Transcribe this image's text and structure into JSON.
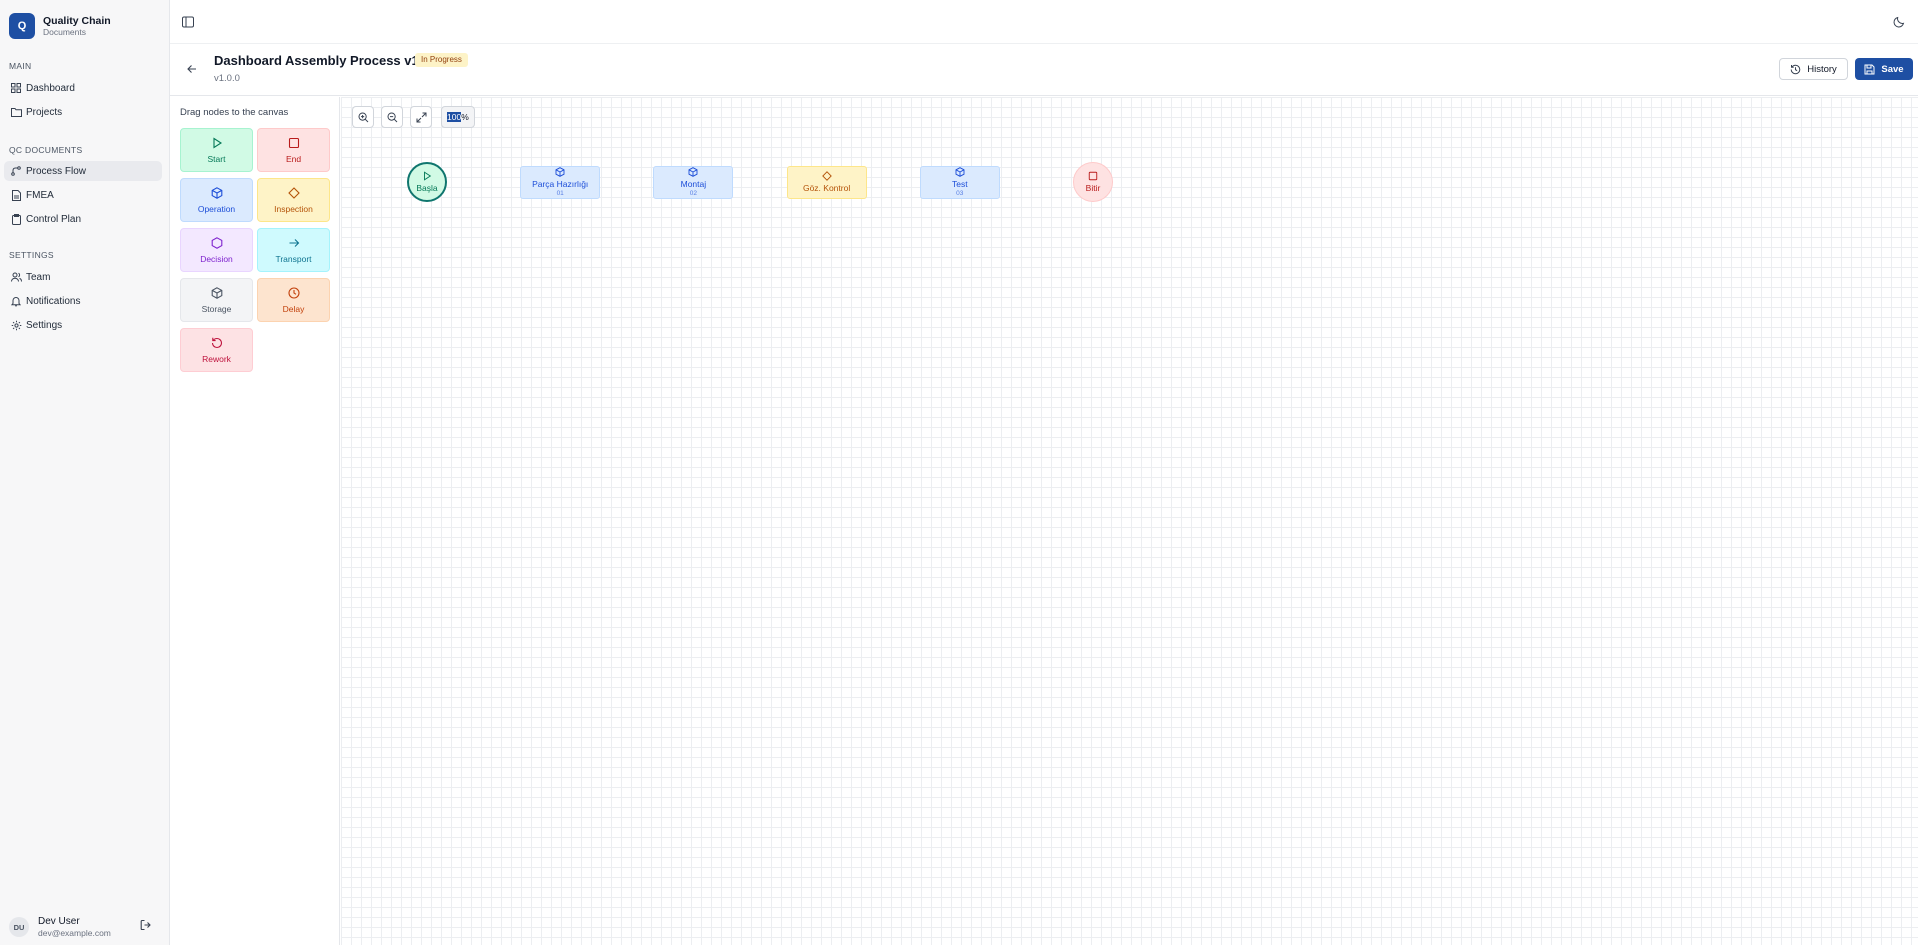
{
  "app": {
    "name": "Quality Chain",
    "subtitle": "Documents",
    "logo_letter": "Q"
  },
  "sidebar": {
    "sections": [
      {
        "label": "MAIN",
        "items": [
          {
            "label": "Dashboard",
            "icon": "grid-icon"
          },
          {
            "label": "Projects",
            "icon": "folder-icon"
          }
        ]
      },
      {
        "label": "QC DOCUMENTS",
        "items": [
          {
            "label": "Process Flow",
            "icon": "workflow-icon",
            "active": true
          },
          {
            "label": "FMEA",
            "icon": "file-icon"
          },
          {
            "label": "Control Plan",
            "icon": "clipboard-icon"
          }
        ]
      },
      {
        "label": "SETTINGS",
        "items": [
          {
            "label": "Team",
            "icon": "users-icon"
          },
          {
            "label": "Notifications",
            "icon": "bell-icon"
          },
          {
            "label": "Settings",
            "icon": "gear-icon"
          }
        ]
      }
    ],
    "user": {
      "initials": "DU",
      "name": "Dev User",
      "email": "dev@example.com"
    }
  },
  "header": {
    "title": "Dashboard Assembly Process v1.0",
    "status": "In Progress",
    "version": "v1.0.0",
    "history_label": "History",
    "save_label": "Save"
  },
  "palette": {
    "title": "Drag nodes to the canvas",
    "nodes": [
      {
        "label": "Start",
        "icon": "play-icon",
        "bg": "#d1fae5",
        "border": "#a7f3d0",
        "color": "#047857"
      },
      {
        "label": "End",
        "icon": "square-icon",
        "bg": "#fee2e2",
        "border": "#fecaca",
        "color": "#b91c1c"
      },
      {
        "label": "Operation",
        "icon": "cube-icon",
        "bg": "#dbeafe",
        "border": "#bfdbfe",
        "color": "#1d4ed8"
      },
      {
        "label": "Inspection",
        "icon": "diamond-icon",
        "bg": "#fef3c7",
        "border": "#fde68a",
        "color": "#b45309"
      },
      {
        "label": "Decision",
        "icon": "hexagon-icon",
        "bg": "#f3e8ff",
        "border": "#e9d5ff",
        "color": "#7e22ce"
      },
      {
        "label": "Transport",
        "icon": "arrow-right-icon",
        "bg": "#cffafe",
        "border": "#a5f3fc",
        "color": "#0e7490"
      },
      {
        "label": "Storage",
        "icon": "box-icon",
        "bg": "#f3f4f6",
        "border": "#e5e7eb",
        "color": "#4b5563"
      },
      {
        "label": "Delay",
        "icon": "clock-icon",
        "bg": "#fde4cf",
        "border": "#fcd3b0",
        "color": "#c2410c"
      },
      {
        "label": "Rework",
        "icon": "rotate-icon",
        "bg": "#fde2e4",
        "border": "#fecdd3",
        "color": "#be123c"
      }
    ]
  },
  "canvas": {
    "zoom_level": "100",
    "zoom_suffix": "%",
    "nodes": [
      {
        "type": "start",
        "label": "Başla"
      },
      {
        "type": "operation",
        "label": "Parça Hazırlığı",
        "number": "01"
      },
      {
        "type": "operation",
        "label": "Montaj",
        "number": "02"
      },
      {
        "type": "inspection",
        "label": "Göz. Kontrol"
      },
      {
        "type": "operation",
        "label": "Test",
        "number": "03"
      },
      {
        "type": "end",
        "label": "Bitir"
      }
    ]
  }
}
